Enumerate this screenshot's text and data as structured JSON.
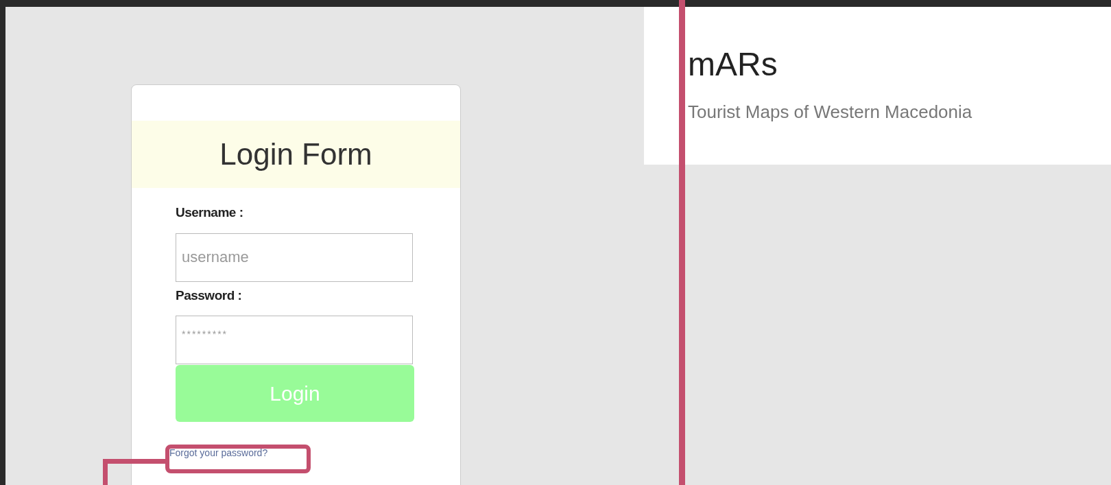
{
  "login_form": {
    "title": "Login Form",
    "fields": [
      {
        "label": "Username :",
        "placeholder": "username",
        "kind": "text"
      },
      {
        "label": "Password :",
        "placeholder": "*********",
        "kind": "password"
      }
    ],
    "submit": "Login",
    "forgot_link": "Forgot your password?"
  },
  "header": {
    "title": "mARs",
    "subtitle": "Tourist Maps of Western Macedonia"
  }
}
